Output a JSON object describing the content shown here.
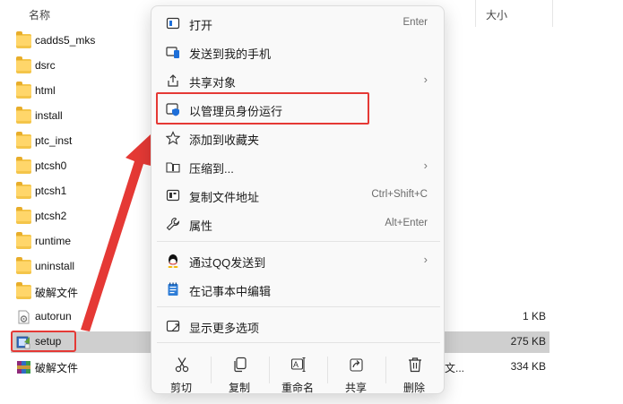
{
  "explorer": {
    "columns": {
      "name": "名称",
      "size": "大小"
    },
    "files": [
      {
        "name": "cadds5_mks",
        "kind": "folder",
        "size": "",
        "type": ""
      },
      {
        "name": "dsrc",
        "kind": "folder",
        "size": "",
        "type": ""
      },
      {
        "name": "html",
        "kind": "folder",
        "size": "",
        "type": ""
      },
      {
        "name": "install",
        "kind": "folder",
        "size": "",
        "type": ""
      },
      {
        "name": "ptc_inst",
        "kind": "folder",
        "size": "",
        "type": ""
      },
      {
        "name": "ptcsh0",
        "kind": "folder",
        "size": "",
        "type": ""
      },
      {
        "name": "ptcsh1",
        "kind": "folder",
        "size": "",
        "type": ""
      },
      {
        "name": "ptcsh2",
        "kind": "folder",
        "size": "",
        "type": ""
      },
      {
        "name": "runtime",
        "kind": "folder",
        "size": "",
        "type": ""
      },
      {
        "name": "uninstall",
        "kind": "folder",
        "size": "",
        "type": ""
      },
      {
        "name": "破解文件",
        "kind": "folder",
        "size": "",
        "type": ""
      },
      {
        "name": "autorun",
        "kind": "settings-file",
        "size": "1 KB",
        "type": ""
      },
      {
        "name": "setup",
        "kind": "setup-exe",
        "size": "275 KB",
        "type": ""
      },
      {
        "name": "破解文件",
        "kind": "archive",
        "size": "334 KB",
        "type": "文..."
      }
    ],
    "selected_file": "setup"
  },
  "context_menu": {
    "items": [
      {
        "label": "打开",
        "shortcut": "Enter",
        "icon": "open-app-icon",
        "submenu": false
      },
      {
        "label": "发送到我的手机",
        "shortcut": "",
        "icon": "phone-link-icon",
        "submenu": false
      },
      {
        "label": "共享对象",
        "shortcut": "",
        "icon": "share-icon",
        "submenu": true
      },
      {
        "label": "以管理员身份运行",
        "shortcut": "",
        "icon": "admin-shield-icon",
        "submenu": false
      },
      {
        "label": "添加到收藏夹",
        "shortcut": "",
        "icon": "star-icon",
        "submenu": false
      },
      {
        "label": "压缩到...",
        "shortcut": "",
        "icon": "compress-icon",
        "submenu": true
      },
      {
        "label": "复制文件地址",
        "shortcut": "Ctrl+Shift+C",
        "icon": "copy-path-icon",
        "submenu": false
      },
      {
        "label": "属性",
        "shortcut": "Alt+Enter",
        "icon": "wrench-icon",
        "submenu": false
      },
      {
        "label": "通过QQ发送到",
        "shortcut": "",
        "icon": "qq-icon",
        "submenu": true
      },
      {
        "label": "在记事本中编辑",
        "shortcut": "",
        "icon": "notepad-icon",
        "submenu": false
      },
      {
        "label": "显示更多选项",
        "shortcut": "",
        "icon": "more-options-icon",
        "submenu": false
      }
    ],
    "arrow_glyph": "›",
    "bottom_actions": [
      {
        "label": "剪切",
        "icon": "scissors-icon"
      },
      {
        "label": "复制",
        "icon": "copy-icon"
      },
      {
        "label": "重命名",
        "icon": "rename-icon"
      },
      {
        "label": "共享",
        "icon": "share-icon"
      },
      {
        "label": "删除",
        "icon": "trash-icon"
      }
    ]
  },
  "colors": {
    "annotation_red": "#e53935",
    "accent_blue": "#1e6fd9",
    "selected_row": "#cfcfcf",
    "menu_bg": "#f9f9f9"
  }
}
